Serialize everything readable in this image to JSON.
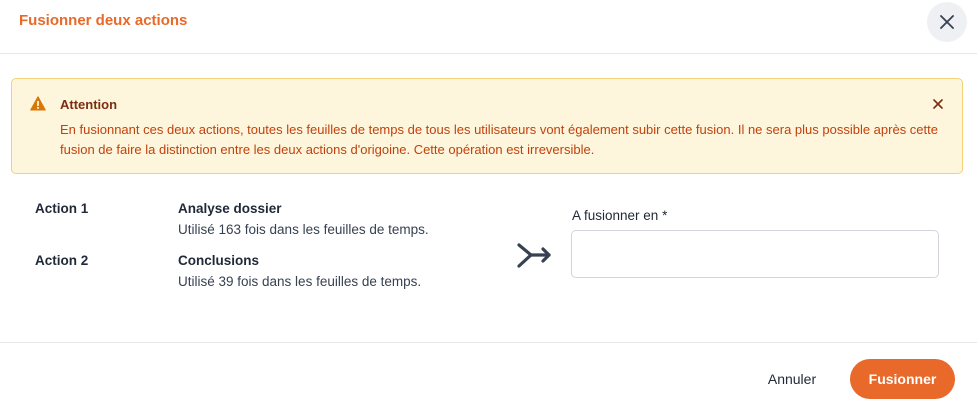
{
  "dialog": {
    "title": "Fusionner deux actions"
  },
  "alert": {
    "title": "Attention",
    "message": "En fusionnant ces deux actions, toutes les feuilles de temps de tous les utilisateurs vont également subir cette fusion. Il ne sera plus possible après cette fusion de faire la distinction entre les deux actions d'origoine. Cette opération est irreversible.",
    "color": "#c2410c"
  },
  "actions": [
    {
      "label": "Action 1",
      "name": "Analyse dossier",
      "usage": "Utilisé 163 fois dans les feuilles de temps."
    },
    {
      "label": "Action 2",
      "name": "Conclusions",
      "usage": "Utilisé 39 fois dans les feuilles de temps."
    }
  ],
  "merge_field": {
    "label": "A fusionner en *",
    "value": ""
  },
  "footer": {
    "cancel_label": "Annuler",
    "submit_label": "Fusionner"
  },
  "colors": {
    "accent": "#e8692a",
    "alert_bg": "#fdf6dc",
    "alert_border": "#f1d27a"
  }
}
